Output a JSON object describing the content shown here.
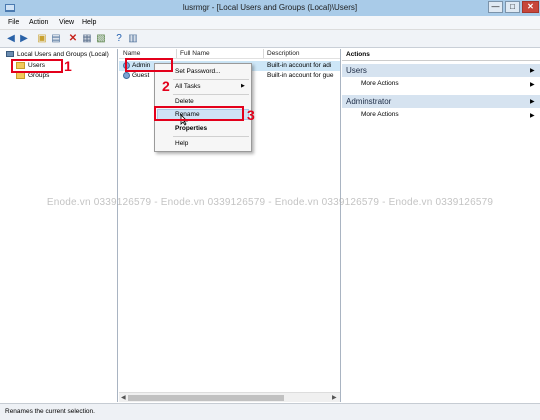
{
  "window": {
    "title": "lusrmgr - [Local Users and Groups (Local)\\Users]",
    "min": "—",
    "max": "□",
    "close": "✕"
  },
  "menu": [
    "File",
    "Action",
    "View",
    "Help"
  ],
  "tree": {
    "root": "Local Users and Groups (Local)",
    "users": "Users",
    "groups": "Groups"
  },
  "list": {
    "columns": [
      "Name",
      "Full Name",
      "Description"
    ],
    "rows": [
      {
        "name": "Admin",
        "full_name": "",
        "description": "Built-in account for adi"
      },
      {
        "name": "Guest",
        "full_name": "",
        "description": "Built-in account for gue"
      }
    ]
  },
  "context_menu": {
    "items": [
      "Set Password...",
      "All Tasks",
      "Delete",
      "Rename",
      "Properties",
      "Help"
    ],
    "submenu_arrow": "▶"
  },
  "actions_pane": {
    "header": "Actions",
    "sections": [
      {
        "title": "Users",
        "items": [
          "More Actions"
        ]
      },
      {
        "title": "Adminstrator",
        "items": [
          "More Actions"
        ]
      }
    ],
    "arrow": "▶"
  },
  "annotations": {
    "one": "1",
    "two": "2",
    "three": "3"
  },
  "watermark": "Enode.vn 0339126579  -  Enode.vn 0339126579  -  Enode.vn 0339126579  -  Enode.vn 0339126579",
  "status_text": "Renames the current selection.",
  "colors": {
    "annotation": "#e3001b",
    "selection": "#cde6f7",
    "section_header": "#d6e3f0"
  }
}
